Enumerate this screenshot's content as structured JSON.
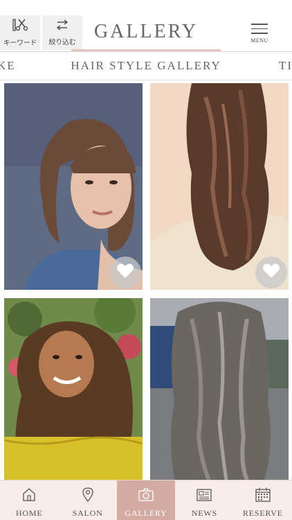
{
  "header": {
    "keyword_label": "キーワード",
    "filter_label": "絞り込む",
    "title": "GALLERY",
    "menu_label": "MENU"
  },
  "category_tabs": {
    "left_partial": "KE",
    "active": "HAIR STYLE GALLERY",
    "right_partial": "TI"
  },
  "gallery": {
    "items": [
      {
        "description": "bob-bangs",
        "favorited": false
      },
      {
        "description": "long-wavy-brown",
        "favorited": false
      },
      {
        "description": "long-beach-waves",
        "favorited": false
      },
      {
        "description": "grey-ash-waves",
        "favorited": false
      }
    ]
  },
  "bottom_nav": {
    "items": [
      {
        "label": "HOME",
        "icon": "home-icon"
      },
      {
        "label": "SALON",
        "icon": "location-pin-icon"
      },
      {
        "label": "GALLERY",
        "icon": "camera-icon",
        "active": true
      },
      {
        "label": "NEWS",
        "icon": "newspaper-icon"
      },
      {
        "label": "RESERVE",
        "icon": "calendar-icon"
      }
    ]
  },
  "colors": {
    "accent": "#d3aba3",
    "accent_light": "#e9c7c0",
    "nav_bg": "#f8ece8"
  }
}
